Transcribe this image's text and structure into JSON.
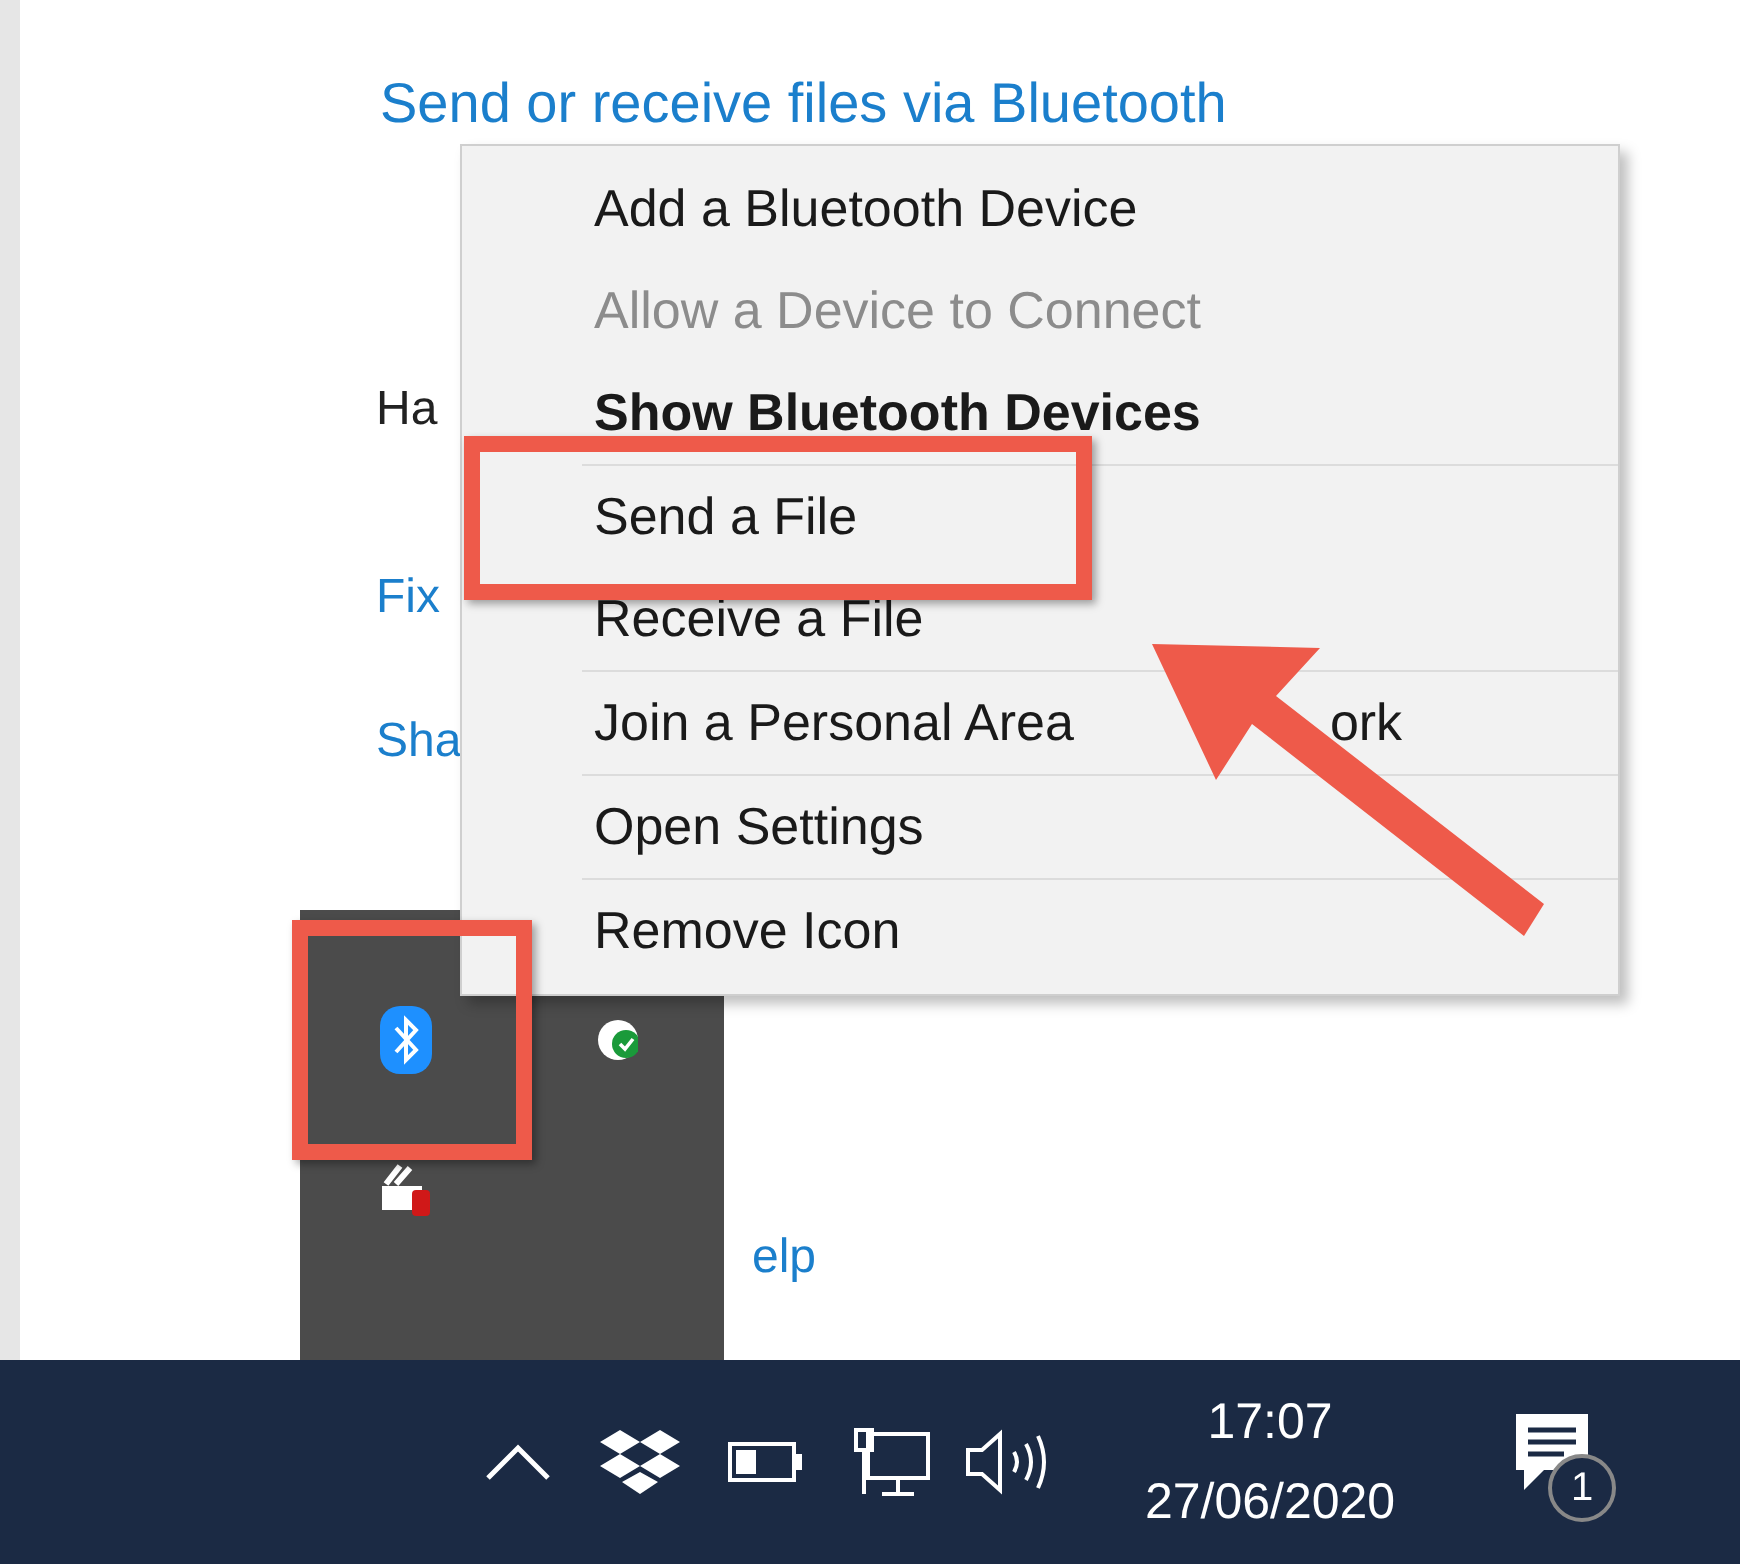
{
  "page": {
    "link_title": "Send or receive files via Bluetooth",
    "fragments": [
      {
        "text": "Ha",
        "kind": "text"
      },
      {
        "text": "Fix",
        "kind": "link"
      },
      {
        "text": "Sha",
        "kind": "link"
      },
      {
        "text": "elp",
        "kind": "link"
      }
    ]
  },
  "context_menu": {
    "items": [
      {
        "label": "Add a Bluetooth Device",
        "disabled": false,
        "default": false,
        "divider_after": false
      },
      {
        "label": "Allow a Device to Connect",
        "disabled": true,
        "default": false,
        "divider_after": false
      },
      {
        "label": "Show Bluetooth Devices",
        "disabled": false,
        "default": true,
        "divider_after": true
      },
      {
        "label": "Send a File",
        "disabled": false,
        "default": false,
        "divider_after": false
      },
      {
        "label": "Receive a File",
        "disabled": false,
        "default": false,
        "divider_after": true
      },
      {
        "label": "Join a Personal Area",
        "label_end": "ork",
        "disabled": false,
        "default": false,
        "divider_after": true
      },
      {
        "label": "Open Settings",
        "disabled": false,
        "default": false,
        "divider_after": true
      },
      {
        "label": "Remove Icon",
        "disabled": false,
        "default": false,
        "divider_after": false
      }
    ]
  },
  "taskbar": {
    "time": "17:07",
    "date": "27/06/2020",
    "notification_count": "1"
  }
}
